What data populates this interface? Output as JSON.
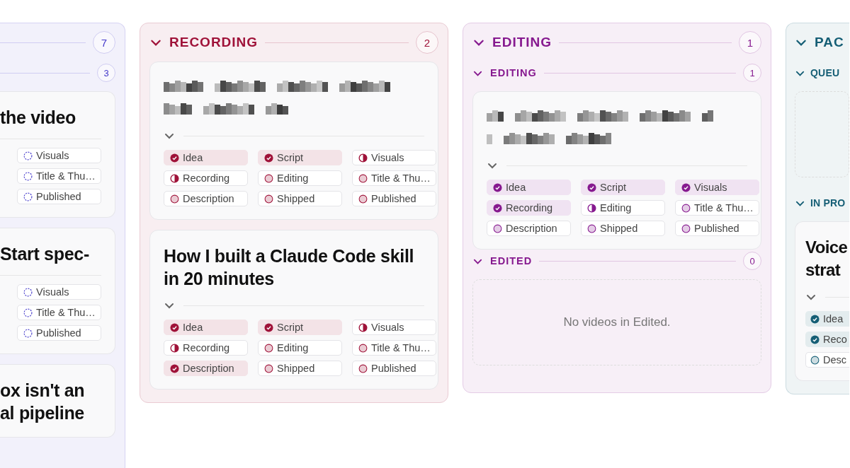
{
  "columns": [
    {
      "kind": "clipped_left",
      "color": "#4338ca",
      "count": "7",
      "groups": [
        {
          "kind": "cards",
          "count": "3",
          "cards": [
            {
              "kind": "text",
              "title": "the video",
              "pills": [
                {
                  "label": "Visuals",
                  "kind": "dashed"
                },
                {
                  "label": "Title & Thu…",
                  "kind": "dashed"
                },
                {
                  "label": "Published",
                  "kind": "dashed"
                }
              ]
            },
            {
              "kind": "text",
              "title": "Start spec-",
              "pills": [
                {
                  "label": "Visuals",
                  "kind": "dashed"
                },
                {
                  "label": "Title & Thu…",
                  "kind": "dashed"
                },
                {
                  "label": "Published",
                  "kind": "dashed"
                }
              ]
            },
            {
              "kind": "text",
              "title": "ox isn't an\nal pipeline"
            }
          ]
        }
      ]
    },
    {
      "kind": "full",
      "color": "#9f1239",
      "title": "RECORDING",
      "count": "2",
      "groups": [
        {
          "kind": "cards",
          "cards": [
            {
              "kind": "redacted",
              "pills": [
                {
                  "label": "Idea",
                  "kind": "done"
                },
                {
                  "label": "Script",
                  "kind": "done"
                },
                {
                  "label": "Visuals",
                  "kind": "half"
                },
                {
                  "label": "Recording",
                  "kind": "half"
                },
                {
                  "label": "Editing",
                  "kind": "empty"
                },
                {
                  "label": "Title & Thu…",
                  "kind": "empty"
                },
                {
                  "label": "Description",
                  "kind": "empty"
                },
                {
                  "label": "Shipped",
                  "kind": "empty"
                },
                {
                  "label": "Published",
                  "kind": "empty"
                }
              ]
            },
            {
              "kind": "text",
              "title": "How I built a Claude Code skill in 20 minutes",
              "pills": [
                {
                  "label": "Idea",
                  "kind": "done"
                },
                {
                  "label": "Script",
                  "kind": "done"
                },
                {
                  "label": "Visuals",
                  "kind": "half"
                },
                {
                  "label": "Recording",
                  "kind": "half"
                },
                {
                  "label": "Editing",
                  "kind": "empty"
                },
                {
                  "label": "Title & Thu…",
                  "kind": "empty"
                },
                {
                  "label": "Description",
                  "kind": "done"
                },
                {
                  "label": "Shipped",
                  "kind": "empty"
                },
                {
                  "label": "Published",
                  "kind": "empty"
                }
              ]
            }
          ]
        }
      ]
    },
    {
      "kind": "full",
      "color": "#86198f",
      "title": "EDITING",
      "count": "1",
      "groups": [
        {
          "kind": "cards",
          "title": "EDITING",
          "count": "1",
          "cards": [
            {
              "kind": "redacted",
              "pills": [
                {
                  "label": "Idea",
                  "kind": "done"
                },
                {
                  "label": "Script",
                  "kind": "done"
                },
                {
                  "label": "Visuals",
                  "kind": "done"
                },
                {
                  "label": "Recording",
                  "kind": "done"
                },
                {
                  "label": "Editing",
                  "kind": "half"
                },
                {
                  "label": "Title & Thu…",
                  "kind": "empty"
                },
                {
                  "label": "Description",
                  "kind": "empty"
                },
                {
                  "label": "Shipped",
                  "kind": "empty"
                },
                {
                  "label": "Published",
                  "kind": "empty"
                }
              ]
            }
          ]
        },
        {
          "kind": "empty",
          "title": "EDITED",
          "count": "0",
          "empty_text": "No videos in Edited."
        }
      ]
    },
    {
      "kind": "clipped_right",
      "color": "#155e75",
      "title": "PAC",
      "groups": [
        {
          "kind": "empty",
          "title": "QUEU"
        },
        {
          "kind": "cards",
          "title": "IN PRO",
          "cards": [
            {
              "kind": "text",
              "title": "Voice\nstrat",
              "pills": [
                {
                  "label": "Idea",
                  "kind": "done"
                },
                {
                  "label": "Reco",
                  "kind": "done"
                },
                {
                  "label": "Desc",
                  "kind": "empty"
                }
              ]
            }
          ]
        }
      ]
    }
  ]
}
